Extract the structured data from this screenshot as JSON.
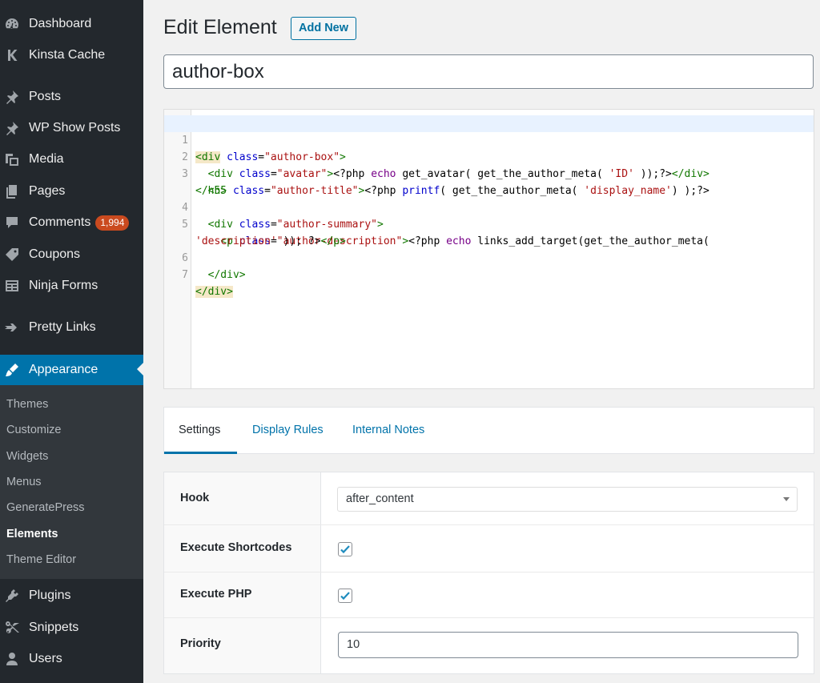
{
  "sidebar": {
    "items": [
      {
        "label": "Dashboard",
        "icon": "dashboard-icon"
      },
      {
        "label": "Kinsta Cache",
        "icon": "kinsta-k-icon"
      },
      {
        "label": "Posts",
        "icon": "pushpin-icon"
      },
      {
        "label": "WP Show Posts",
        "icon": "pushpin-icon"
      },
      {
        "label": "Media",
        "icon": "media-icon"
      },
      {
        "label": "Pages",
        "icon": "pages-icon"
      },
      {
        "label": "Comments",
        "icon": "comment-bubble-icon",
        "badge": "1,994"
      },
      {
        "label": "Coupons",
        "icon": "tag-icon"
      },
      {
        "label": "Ninja Forms",
        "icon": "form-icon"
      },
      {
        "label": "Pretty Links",
        "icon": "star-arrow-icon"
      },
      {
        "label": "Appearance",
        "icon": "paintbrush-icon",
        "active": true
      },
      {
        "label": "Plugins",
        "icon": "plug-icon"
      },
      {
        "label": "Snippets",
        "icon": "scissors-icon"
      },
      {
        "label": "Users",
        "icon": "user-icon"
      }
    ],
    "submenu": [
      "Themes",
      "Customize",
      "Widgets",
      "Menus",
      "GeneratePress",
      "Elements",
      "Theme Editor"
    ],
    "submenu_current": "Elements"
  },
  "main": {
    "title": "Edit Element",
    "add_new": "Add New",
    "post_title": "author-box",
    "code_lines": [
      {
        "num": "1",
        "text": "<div class=\"author-box\">"
      },
      {
        "num": "2",
        "text": "  <div class=\"avatar\"><?php echo get_avatar( get_the_author_meta( 'ID' ));?></div>"
      },
      {
        "num": "3",
        "text": "  <h5 class=\"author-title\"><?php printf( get_the_author_meta( 'display_name') );?>"
      },
      {
        "num": "",
        "text": "</h5>"
      },
      {
        "num": "4",
        "text": "  <div class=\"author-summary\">"
      },
      {
        "num": "5",
        "text": "    <p class=\"author-description\"><?php echo links_add_target(get_the_author_meta("
      },
      {
        "num": "",
        "text": "'description' )); ?></p>"
      },
      {
        "num": "6",
        "text": "  </div>"
      },
      {
        "num": "7",
        "text": "</div>"
      }
    ],
    "tabs": [
      "Settings",
      "Display Rules",
      "Internal Notes"
    ],
    "active_tab": "Settings",
    "settings": {
      "hook_label": "Hook",
      "hook_value": "after_content",
      "shortcodes_label": "Execute Shortcodes",
      "shortcodes_checked": true,
      "php_label": "Execute PHP",
      "php_checked": true,
      "priority_label": "Priority",
      "priority_value": "10"
    }
  },
  "colors": {
    "sidebar_bg": "#23282d",
    "submenu_bg": "#32373c",
    "accent": "#0073aa",
    "badge": "#ca4a1f"
  }
}
